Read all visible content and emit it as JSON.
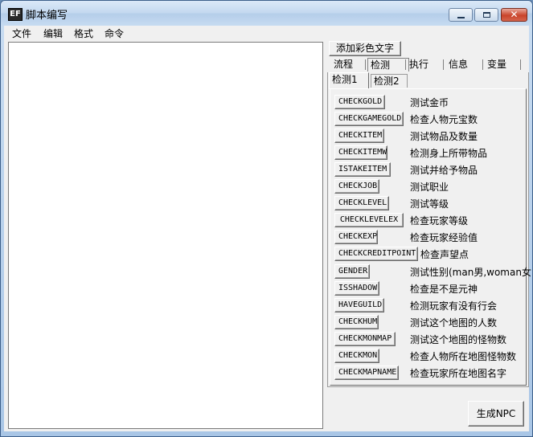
{
  "window": {
    "title": "脚本编写",
    "app_icon_text": "EF"
  },
  "menubar": [
    "文件",
    "编辑",
    "格式",
    "命令"
  ],
  "editor": {
    "value": ""
  },
  "toolbar": {
    "add_color_text_label": "添加彩色文字"
  },
  "main_tabs": {
    "labels": [
      "流程",
      "检测",
      "执行",
      "信息",
      "变量"
    ],
    "active": "检测"
  },
  "sub_tabs": {
    "labels": [
      "检测1",
      "检测2"
    ],
    "active": "检测1"
  },
  "commands": [
    {
      "name": "CHECKGOLD",
      "desc": "测试金币"
    },
    {
      "name": "CHECKGAMEGOLD",
      "desc": "检查人物元宝数"
    },
    {
      "name": "CHECKITEM",
      "desc": "测试物品及数量"
    },
    {
      "name": "CHECKITEMW",
      "desc": "检测身上所带物品"
    },
    {
      "name": "ISTAKEITEM",
      "desc": "测试并给予物品"
    },
    {
      "name": "CHECKJOB",
      "desc": "测试职业"
    },
    {
      "name": "CHECKLEVEL",
      "desc": "测试等级"
    },
    {
      "name": "CHECKLEVELEX",
      "desc": "检查玩家等级"
    },
    {
      "name": "CHECKEXP",
      "desc": "检查玩家经验值"
    },
    {
      "name": "CHECKCREDITPOINT",
      "desc": "检查声望点"
    },
    {
      "name": "GENDER",
      "desc": "测试性别(man男,woman女)"
    },
    {
      "name": "ISSHADOW",
      "desc": "检查是不是元神"
    },
    {
      "name": "HAVEGUILD",
      "desc": "检测玩家有没有行会"
    },
    {
      "name": "CHECKHUM",
      "desc": "测试这个地图的人数"
    },
    {
      "name": "CHECKMONMAP",
      "desc": "测试这个地图的怪物数"
    },
    {
      "name": "CHECKMON",
      "desc": "检查人物所在地图怪物数"
    },
    {
      "name": "CHECKMAPNAME",
      "desc": "检查玩家所在地图名字"
    }
  ],
  "footer": {
    "generate_npc_label": "生成NPC"
  }
}
